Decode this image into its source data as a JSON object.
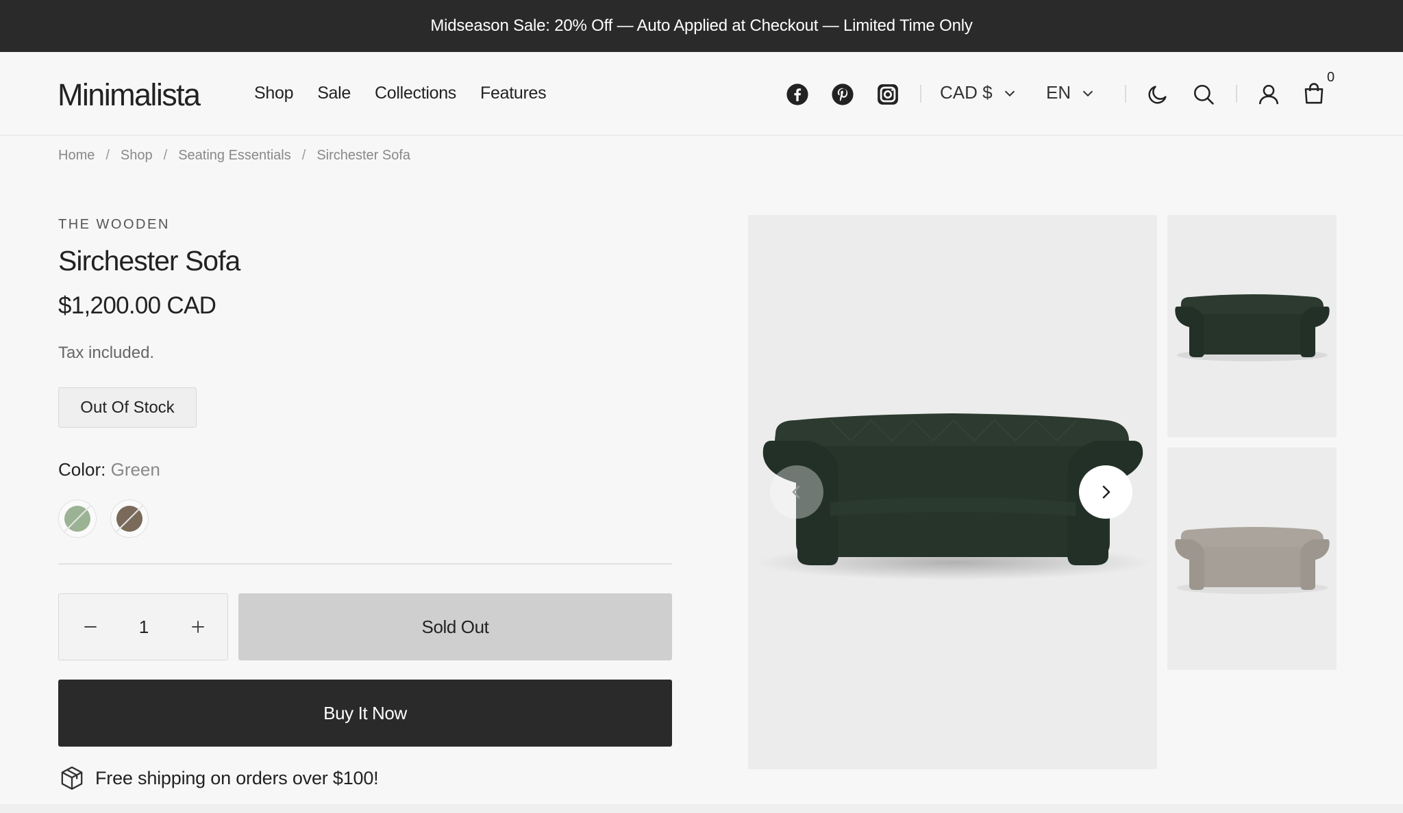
{
  "announcement": "Midseason Sale: 20% Off — Auto Applied at Checkout — Limited Time Only",
  "header": {
    "logo": "Minimalista",
    "nav": [
      "Shop",
      "Sale",
      "Collections",
      "Features"
    ],
    "social_icons": [
      "facebook-icon",
      "pinterest-icon",
      "instagram-icon"
    ],
    "currency": "CAD $",
    "language": "EN",
    "cart_count": "0"
  },
  "breadcrumb": [
    "Home",
    "Shop",
    "Seating Essentials",
    "Sirchester Sofa"
  ],
  "product": {
    "vendor": "THE WOODEN",
    "title": "Sirchester Sofa",
    "price": "$1,200.00 CAD",
    "tax_note": "Tax included.",
    "stock_badge": "Out Of Stock",
    "color_label": "Color:",
    "color_value": "Green",
    "swatches": [
      {
        "name": "Green",
        "hex": "#9bb394"
      },
      {
        "name": "Brown",
        "hex": "#7a6a5a"
      }
    ],
    "quantity": "1",
    "sold_out_label": "Sold Out",
    "buy_now_label": "Buy It Now",
    "shipping_note": "Free shipping on orders over $100!"
  },
  "colors": {
    "announcement_bg": "#2a2a2a",
    "page_bg": "#f7f7f7",
    "buy_now_bg": "#2a2a2a",
    "sold_out_bg": "#cfcfcf",
    "sofa_green": "#253228",
    "sofa_grey": "#a9a39b"
  }
}
